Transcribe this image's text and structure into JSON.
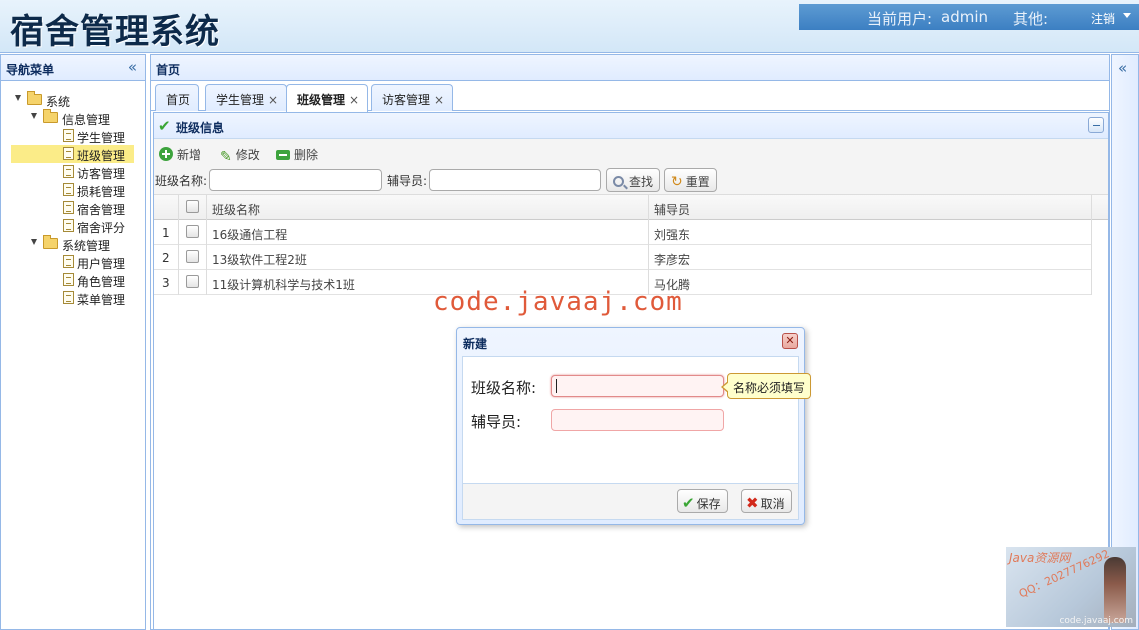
{
  "header": {
    "app_title": "宿舍管理系统",
    "current_user_label": "当前用户:",
    "current_user": "admin",
    "other_label": "其他:",
    "logout_label": "注销"
  },
  "west": {
    "title": "导航菜单",
    "tree": [
      {
        "label": "系统",
        "type": "folder",
        "level": 0,
        "selected": false
      },
      {
        "label": "信息管理",
        "type": "folder",
        "level": 1,
        "selected": false
      },
      {
        "label": "学生管理",
        "type": "file",
        "level": 2,
        "selected": false
      },
      {
        "label": "班级管理",
        "type": "file",
        "level": 2,
        "selected": true
      },
      {
        "label": "访客管理",
        "type": "file",
        "level": 2,
        "selected": false
      },
      {
        "label": "损耗管理",
        "type": "file",
        "level": 2,
        "selected": false
      },
      {
        "label": "宿舍管理",
        "type": "file",
        "level": 2,
        "selected": false
      },
      {
        "label": "宿舍评分",
        "type": "file",
        "level": 2,
        "selected": false
      },
      {
        "label": "系统管理",
        "type": "folder",
        "level": 1,
        "selected": false
      },
      {
        "label": "用户管理",
        "type": "file",
        "level": 2,
        "selected": false
      },
      {
        "label": "角色管理",
        "type": "file",
        "level": 2,
        "selected": false
      },
      {
        "label": "菜单管理",
        "type": "file",
        "level": 2,
        "selected": false
      }
    ]
  },
  "center": {
    "title": "首页",
    "tabs": [
      {
        "label": "首页",
        "closable": false,
        "active": false
      },
      {
        "label": "学生管理",
        "closable": true,
        "active": false
      },
      {
        "label": "班级管理",
        "closable": true,
        "active": true
      },
      {
        "label": "访客管理",
        "closable": true,
        "active": false
      }
    ],
    "tab_close_glyph": "×",
    "panel_title": "班级信息",
    "toolbar": {
      "add_label": "新增",
      "edit_label": "修改",
      "delete_label": "删除",
      "class_name_label": "班级名称:",
      "tutor_label": "辅导员:",
      "search_label": "查找",
      "reset_label": "重置"
    },
    "grid": {
      "headers": {
        "name": "班级名称",
        "tutor": "辅导员"
      },
      "rows": [
        {
          "num": "1",
          "name": "16级通信工程",
          "tutor": "刘强东"
        },
        {
          "num": "2",
          "name": "13级软件工程2班",
          "tutor": "李彦宏"
        },
        {
          "num": "3",
          "name": "11级计算机科学与技术1班",
          "tutor": "马化腾"
        }
      ]
    }
  },
  "watermark": "code.javaaj.com",
  "dialog": {
    "title": "新建",
    "class_name_label": "班级名称:",
    "tutor_label": "辅导员:",
    "class_name_value": "",
    "tutor_value": "",
    "validation_tip": "名称必须填写",
    "save_label": "保存",
    "cancel_label": "取消"
  },
  "corner_badge": {
    "brand": "Java资源网",
    "qq": "QQ：2027776292",
    "url": "code.javaaj.com"
  },
  "colors": {
    "border": "#95b8e7",
    "header_bg": "#d3e7f7",
    "userbar_bg": "#3c7fc2",
    "selected_node": "#fbec88",
    "watermark": "#e05a3a",
    "tooltip_bg": "#ffffcc"
  }
}
